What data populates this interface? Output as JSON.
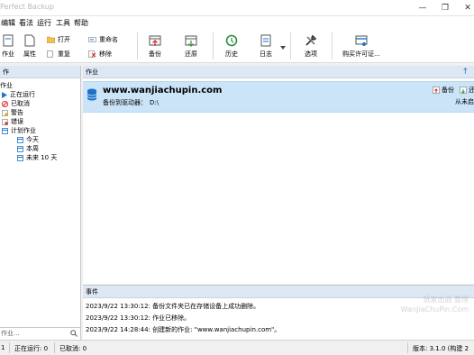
{
  "window": {
    "title": "Perfect Backup",
    "minimize": "—",
    "restore": "❐",
    "close": "✕"
  },
  "menu": {
    "items": [
      {
        "label": "编辑"
      },
      {
        "label": "看法"
      },
      {
        "label": "运行"
      },
      {
        "label": "工具"
      },
      {
        "label": "帮助"
      }
    ]
  },
  "toolbar": {
    "new_job": "作业",
    "properties": "属性",
    "open": "打开",
    "rename": "重命名",
    "reset": "重复",
    "remove": "移除",
    "backup": "备份",
    "restore": "还原",
    "history": "历史",
    "log": "日志",
    "options": "选项",
    "buy": "购买许可证..."
  },
  "left_pane": {
    "header": "作",
    "tree": {
      "root": "作业",
      "running": "正在运行",
      "cancelled": "已取消",
      "warnings": "警告",
      "errors": "错误",
      "scheduled": "计划作业",
      "today": "今天",
      "this_week": "本周",
      "next_10_days": "未来 10 天"
    },
    "search_placeholder": "作业..."
  },
  "jobs_pane": {
    "header": "作业",
    "sort_arrow": "↑",
    "job": {
      "name": "www.wanjiachupin.com",
      "destination_label": "备份到驱动器：",
      "destination_value": "D:\\",
      "backup_action": "备份",
      "restore_action": "还",
      "next_run": "从未启"
    }
  },
  "events_pane": {
    "header": "事件",
    "rows": [
      {
        "text": "2023/9/22 13:30:12: 备份文件夹已在存储设备上成功删除。"
      },
      {
        "text": "2023/9/22 13:30:12: 作业已移除。"
      },
      {
        "text": "2023/9/22 14:28:44: 创建新的作业: \"www.wanjiachupin.com\"。"
      }
    ]
  },
  "status_bar": {
    "jobs": "1",
    "running": "正在运行: 0",
    "cancelled": "已取消: 0",
    "version": "版本: 3.1.0 (构建 2"
  },
  "watermark": {
    "line1": "玩家出品 整理",
    "line2": "WanJiaChuPin.Com"
  },
  "colors": {
    "accent_blue": "#1e73c8",
    "selection": "#cce4f7",
    "header_bg": "#dde8f4",
    "history_green": "#2f8f3a"
  }
}
